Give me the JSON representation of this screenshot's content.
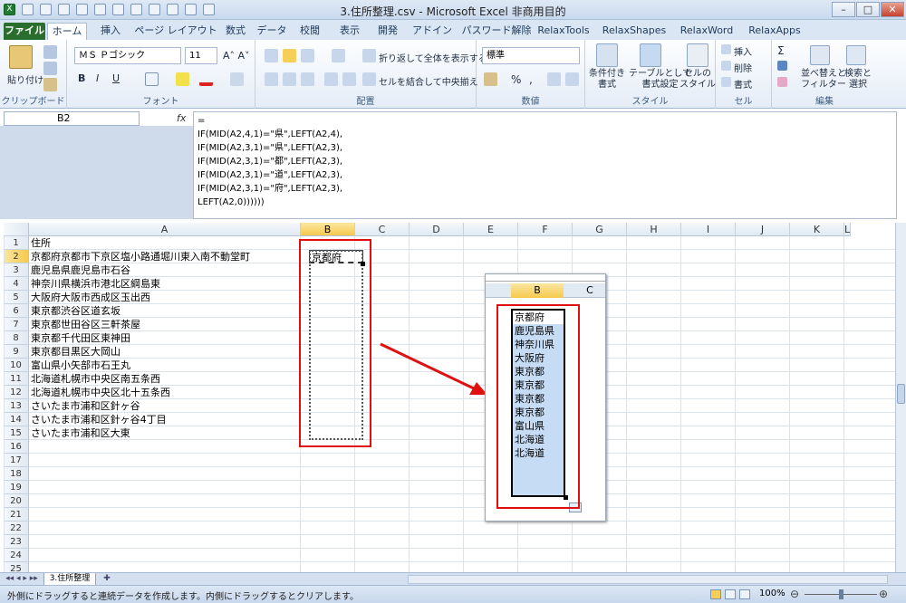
{
  "window": {
    "title": "3.住所整理.csv - Microsoft Excel 非商用目的",
    "app_icon": "excel-icon"
  },
  "ribbon_tabs": [
    "ファイル",
    "ホーム",
    "挿入",
    "ページ レイアウト",
    "数式",
    "データ",
    "校閲",
    "表示",
    "開発",
    "アドイン",
    "パスワード解除",
    "RelaxTools",
    "RelaxShapes",
    "RelaxWord",
    "RelaxApps"
  ],
  "ribbon": {
    "clipboard": {
      "paste": "貼り付け",
      "label": "クリップボード"
    },
    "font": {
      "name": "ＭＳ Ｐゴシック",
      "size": "11",
      "bold": "B",
      "italic": "I",
      "underline": "U",
      "label": "フォント"
    },
    "alignment": {
      "wrap": "折り返して全体を表示する",
      "merge": "セルを結合して中央揃え",
      "label": "配置"
    },
    "number": {
      "format": "標準",
      "percent": "%",
      "comma": ",",
      "label": "数値"
    },
    "styles": {
      "conditional": "条件付き\n書式",
      "table": "テーブルとして\n書式設定",
      "cell_styles": "セルの\nスタイル",
      "label": "スタイル"
    },
    "cells": {
      "insert": "挿入",
      "delete": "削除",
      "format": "書式",
      "label": "セル"
    },
    "editing": {
      "sort": "並べ替えと\nフィルター",
      "find": "検索と\n選択",
      "label": "編集"
    }
  },
  "formula_bar": {
    "name_box": "B2",
    "fx": "fx",
    "formula_lines": [
      "=",
      "IF(MID(A2,4,1)=\"県\",LEFT(A2,4),",
      "IF(MID(A2,3,1)=\"県\",LEFT(A2,3),",
      "IF(MID(A2,3,1)=\"都\",LEFT(A2,3),",
      "IF(MID(A2,3,1)=\"道\",LEFT(A2,3),",
      "IF(MID(A2,3,1)=\"府\",LEFT(A2,3),",
      "LEFT(A2,0))))))"
    ]
  },
  "grid": {
    "columns": [
      "A",
      "B",
      "C",
      "D",
      "E",
      "F",
      "G",
      "H",
      "I",
      "J",
      "K",
      "L"
    ],
    "rows": [
      "1",
      "2",
      "3",
      "4",
      "5",
      "6",
      "7",
      "8",
      "9",
      "10",
      "11",
      "12",
      "13",
      "14",
      "15",
      "16",
      "17",
      "18",
      "19",
      "20",
      "21",
      "22",
      "23",
      "24",
      "25"
    ],
    "col_a": [
      "住所",
      "京都府京都市下京区塩小路通堀川東入南不動堂町",
      "鹿児島県鹿児島市石谷",
      "神奈川県横浜市港北区綱島東",
      "大阪府大阪市西成区玉出西",
      "東京都渋谷区道玄坂",
      "東京都世田谷区三軒茶屋",
      "東京都千代田区東神田",
      "東京都目黒区大岡山",
      "富山県小矢部市石王丸",
      "北海道札幌市中央区南五条西",
      "北海道札幌市中央区北十五条西",
      "さいたま市浦和区針ヶ谷",
      "さいたま市浦和区針ヶ谷4丁目",
      "さいたま市浦和区大東"
    ],
    "b2": "京都府"
  },
  "callout": {
    "col_b": "B",
    "col_c": "C",
    "values": [
      "京都府",
      "鹿児島県",
      "神奈川県",
      "大阪府",
      "東京都",
      "東京都",
      "東京都",
      "東京都",
      "富山県",
      "北海道",
      "北海道"
    ]
  },
  "sheet_tab": "3.住所整理",
  "status": {
    "message": "外側にドラッグすると連続データを作成します。内側にドラッグするとクリアします。",
    "zoom": "100%"
  },
  "colors": {
    "accent": "#e01010",
    "selection": "#c6dcf5",
    "header_sel": "#f5c94d",
    "file_tab": "#2a6e2e"
  }
}
